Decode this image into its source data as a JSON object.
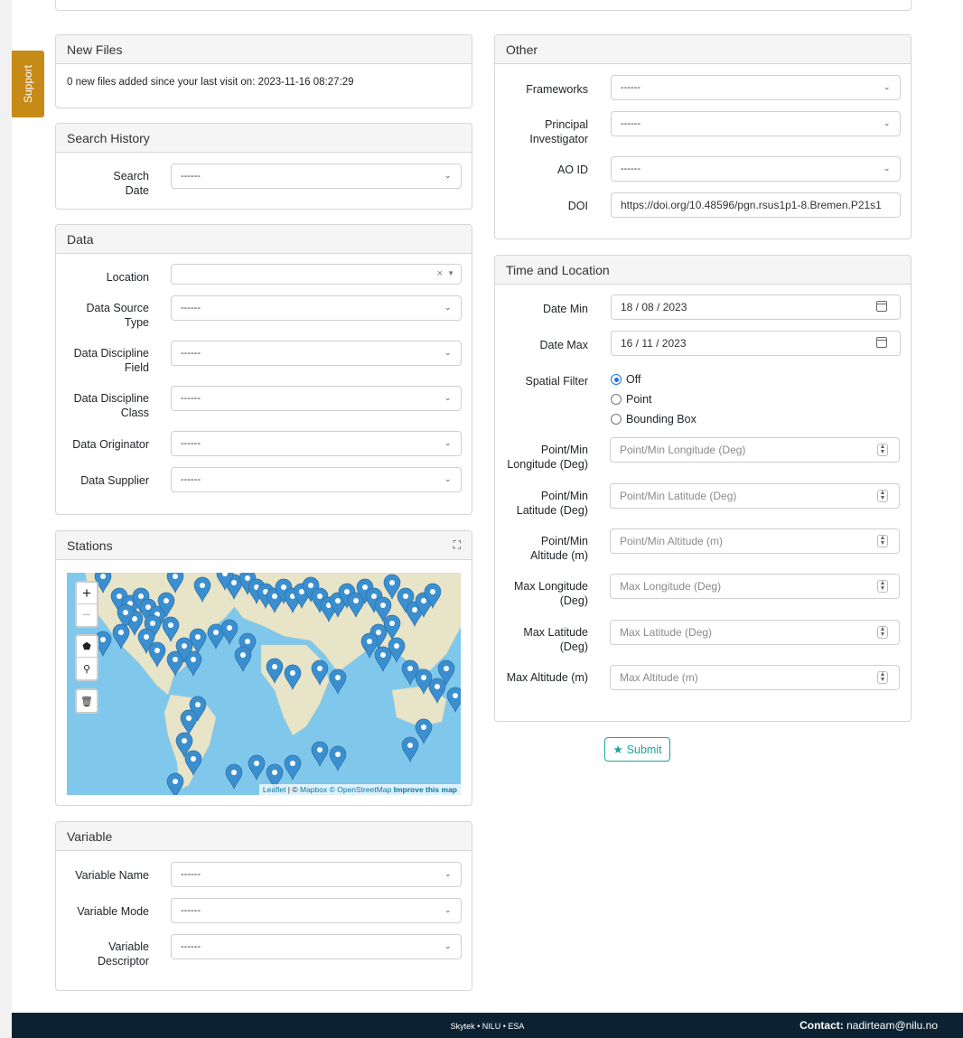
{
  "support": {
    "label": "Support"
  },
  "new_files": {
    "title": "New Files",
    "message": "0 new files added since your last visit on: 2023-11-16 08:27:29"
  },
  "search_history": {
    "title": "Search History",
    "search_date_label": "Search Date",
    "search_date_value": "------"
  },
  "data": {
    "title": "Data",
    "location_label": "Location",
    "location_value": "",
    "source_type_label": "Data Source Type",
    "source_type_value": "------",
    "discipline_field_label": "Data Discipline Field",
    "discipline_field_value": "------",
    "discipline_class_label": "Data Discipline Class",
    "discipline_class_value": "------",
    "originator_label": "Data Originator",
    "originator_value": "------",
    "supplier_label": "Data Supplier",
    "supplier_value": "------"
  },
  "stations": {
    "title": "Stations",
    "map_controls": {
      "zoom_in": "+",
      "zoom_out": "−"
    },
    "attribution": {
      "leaflet": "Leaflet",
      "sep": " | © ",
      "mapbox": "Mapbox",
      "osm": " © OpenStreetMap ",
      "improve": "Improve this map"
    }
  },
  "variable": {
    "title": "Variable",
    "name_label": "Variable Name",
    "name_value": "------",
    "mode_label": "Variable Mode",
    "mode_value": "------",
    "descriptor_label": "Variable Descriptor",
    "descriptor_value": "------"
  },
  "other": {
    "title": "Other",
    "frameworks_label": "Frameworks",
    "frameworks_value": "------",
    "pi_label": "Principal Investigator",
    "pi_value": "------",
    "ao_label": "AO ID",
    "ao_value": "------",
    "doi_label": "DOI",
    "doi_value": "https://doi.org/10.48596/pgn.rsus1p1-8.Bremen.P21s1"
  },
  "time_location": {
    "title": "Time and Location",
    "date_min_label": "Date Min",
    "date_min_value": "18 / 08 / 2023",
    "date_max_label": "Date Max",
    "date_max_value": "16 / 11 / 2023",
    "spatial_label": "Spatial Filter",
    "spatial_options": [
      "Off",
      "Point",
      "Bounding Box"
    ],
    "spatial_selected": "Off",
    "fields": [
      {
        "label": "Point/Min Longitude (Deg)",
        "placeholder": "Point/Min Longitude (Deg)"
      },
      {
        "label": "Point/Min Latitude (Deg)",
        "placeholder": "Point/Min Latitude (Deg)"
      },
      {
        "label": "Point/Min Altitude (m)",
        "placeholder": "Point/Min Altitude (m)"
      },
      {
        "label": "Max Longitude (Deg)",
        "placeholder": "Max Longitude (Deg)"
      },
      {
        "label": "Max Latitude (Deg)",
        "placeholder": "Max Latitude (Deg)"
      },
      {
        "label": "Max Altitude (m)",
        "placeholder": "Max Altitude (m)"
      }
    ]
  },
  "submit": {
    "label": "Submit"
  },
  "footer": {
    "credits": "Skytek • NILU • ESA",
    "contact_label": "Contact:",
    "contact_email": "nadirteam@nilu.no"
  },
  "colors": {
    "support": "#c68a16",
    "submit": "#1aa39a",
    "footer": "#0c2233",
    "marker": "#3a8fd0",
    "ocean": "#7fc8ec",
    "land": "#e7e4c8"
  }
}
